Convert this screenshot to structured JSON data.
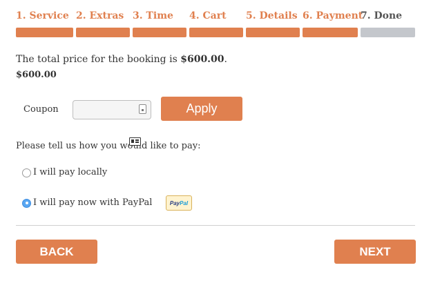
{
  "steps": [
    {
      "label": "1. Service",
      "state": "done"
    },
    {
      "label": "2. Extras",
      "state": "done"
    },
    {
      "label": "3. Time",
      "state": "done"
    },
    {
      "label": "4. Cart",
      "state": "done"
    },
    {
      "label": "5. Details",
      "state": "done"
    },
    {
      "label": "6. Payment",
      "state": "done"
    },
    {
      "label": "7. Done",
      "state": "pending"
    }
  ],
  "colors": {
    "accent": "#e0804f",
    "step_done_text": "#e0804f",
    "step_pending_text": "#555555",
    "step_pending_bar": "#c4c7cc",
    "radio_selected": "#5aa7f2"
  },
  "summary": {
    "total_prefix": "The total price for the booking is ",
    "total_value": "$600.00",
    "total_suffix": ".",
    "amount": "$600.00"
  },
  "coupon": {
    "label": "Coupon",
    "value": "",
    "placeholder": "",
    "apply_label": "Apply"
  },
  "payment": {
    "question": "Please tell us how you would like to pay:",
    "options": [
      {
        "label": "I will pay locally",
        "selected": false
      },
      {
        "label": "I will pay now with PayPal",
        "selected": true
      }
    ],
    "paypal_logo_a": "Pay",
    "paypal_logo_b": "Pal"
  },
  "navigation": {
    "back_label": "BACK",
    "next_label": "NEXT"
  }
}
